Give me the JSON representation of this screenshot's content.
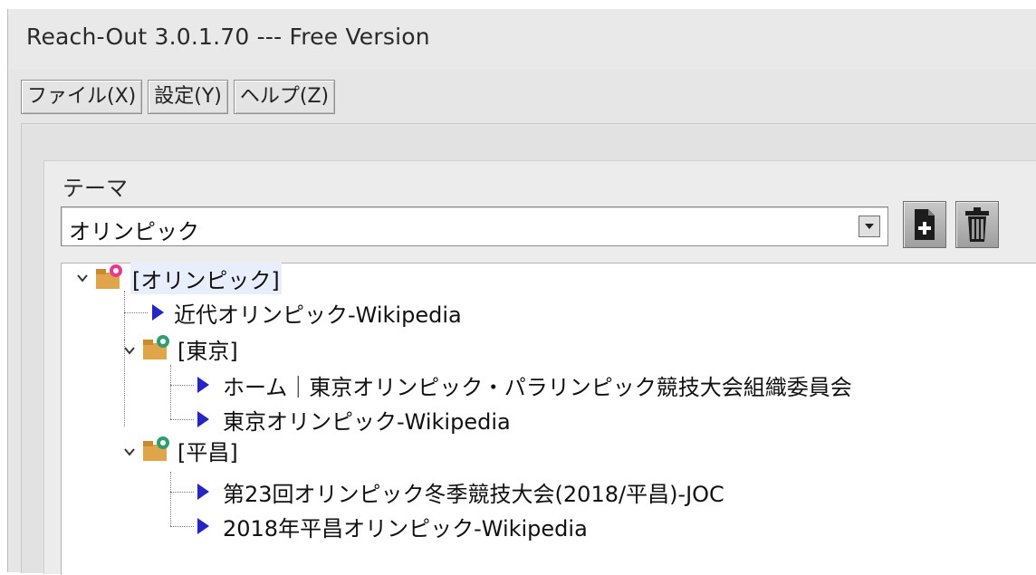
{
  "window": {
    "title": "Reach-Out 3.0.1.70 --- Free Version"
  },
  "menu": {
    "items": [
      {
        "label": "ファイル(X)"
      },
      {
        "label": "設定(Y)"
      },
      {
        "label": "ヘルプ(Z)"
      }
    ]
  },
  "theme": {
    "label": "テーマ",
    "selected": "オリンピック"
  },
  "toolbar": {
    "add_icon": "add-document-icon",
    "delete_icon": "trash-icon"
  },
  "tree": {
    "root": {
      "label": "[オリンピック]",
      "expanded": true,
      "children": [
        {
          "type": "link",
          "label": "近代オリンピック-Wikipedia"
        },
        {
          "type": "folder",
          "label": "[東京]",
          "expanded": true,
          "children": [
            {
              "type": "link",
              "label": "ホーム｜東京オリンピック・パラリンピック競技大会組織委員会"
            },
            {
              "type": "link",
              "label": "東京オリンピック-Wikipedia"
            }
          ]
        },
        {
          "type": "folder",
          "label": "[平昌]",
          "expanded": true,
          "children": [
            {
              "type": "link",
              "label": "第23回オリンピック冬季競技大会(2018/平昌)-JOC"
            },
            {
              "type": "link",
              "label": "2018年平昌オリンピック-Wikipedia"
            }
          ]
        }
      ]
    }
  },
  "colors": {
    "link_arrow": "#2525c6",
    "selection": "#e8eefb"
  }
}
